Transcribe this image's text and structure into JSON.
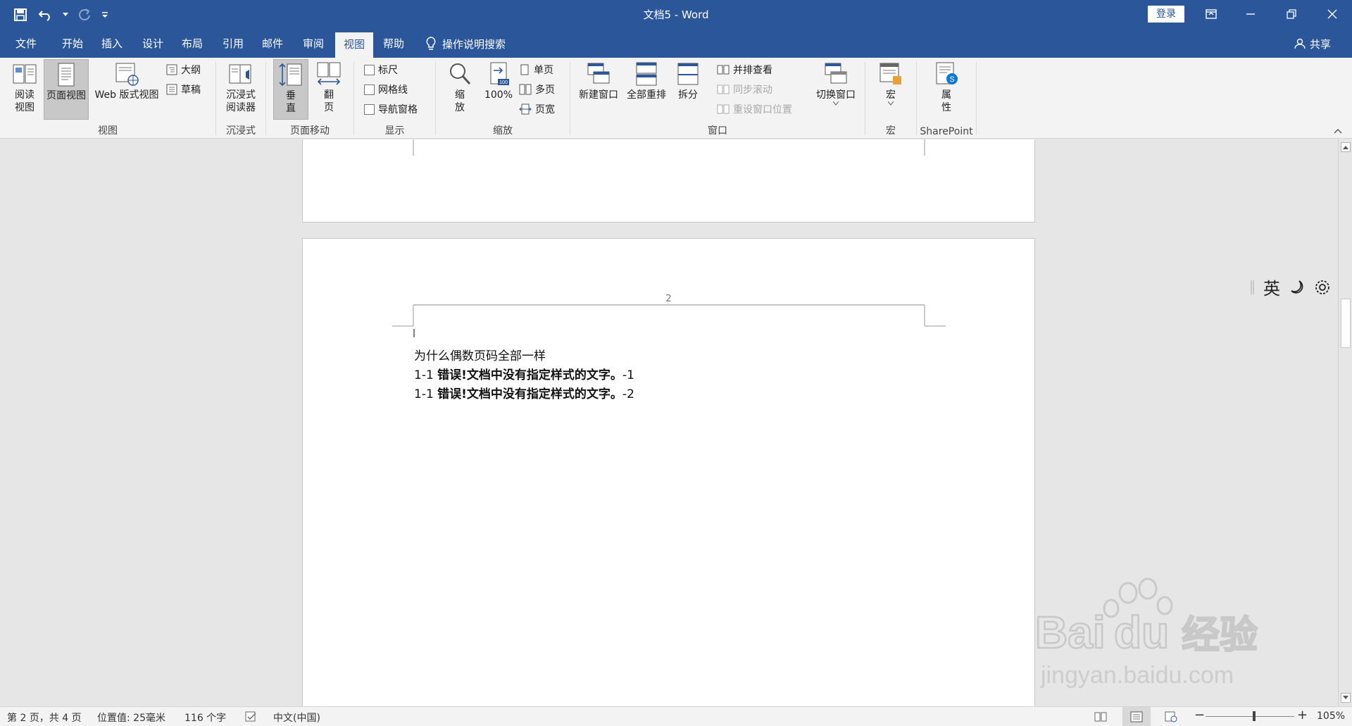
{
  "window": {
    "title": "文档5 - Word",
    "login_label": "登录",
    "controls": [
      "ribbon-display-options",
      "minimize",
      "restore",
      "close"
    ]
  },
  "qat": {
    "icons": [
      "save-icon",
      "undo-icon",
      "redo-icon",
      "customize-icon"
    ]
  },
  "tabs": [
    {
      "label": "文件"
    },
    {
      "label": "开始"
    },
    {
      "label": "插入"
    },
    {
      "label": "设计"
    },
    {
      "label": "布局"
    },
    {
      "label": "引用"
    },
    {
      "label": "邮件"
    },
    {
      "label": "审阅"
    },
    {
      "label": "视图",
      "active": true
    },
    {
      "label": "帮助"
    }
  ],
  "tell_me": "操作说明搜索",
  "share": "共享",
  "ribbon": {
    "views": {
      "group_label": "视图",
      "read_mode": "阅读\n视图",
      "print_layout": "页面视图",
      "web_layout": "Web 版式视图",
      "outline": "大纲",
      "draft": "草稿"
    },
    "immersive": {
      "group_label": "沉浸式",
      "reader": "沉浸式\n阅读器"
    },
    "page_movement": {
      "group_label": "页面移动",
      "vertical": "垂\n直",
      "side_to_side": "翻\n页"
    },
    "show": {
      "group_label": "显示",
      "ruler": "标尺",
      "gridlines": "网格线",
      "nav_pane": "导航窗格"
    },
    "zoom": {
      "group_label": "缩放",
      "zoom": "缩\n放",
      "zoom_100": "100%",
      "one_page": "单页",
      "multiple_pages": "多页",
      "page_width": "页宽"
    },
    "window": {
      "group_label": "窗口",
      "new_window": "新建窗口",
      "arrange_all": "全部重排",
      "split": "拆分",
      "side_by_side": "并排查看",
      "sync_scroll": "同步滚动",
      "reset_position": "重设窗口位置",
      "switch_windows": "切换窗口"
    },
    "macros": {
      "group_label": "宏",
      "macros": "宏"
    },
    "sharepoint": {
      "group_label": "SharePoint",
      "properties": "属\n性"
    }
  },
  "document": {
    "page_number": "2",
    "lines": [
      {
        "text": "为什么偶数页码全部一样"
      },
      {
        "prefix": "1-1 ",
        "bold": "错误!文档中没有指定样式的文字。",
        "suffix": "-1"
      },
      {
        "prefix": "1-1 ",
        "bold": "错误!文档中没有指定样式的文字。",
        "suffix": "-2"
      }
    ]
  },
  "ime": {
    "lang": "英"
  },
  "status": {
    "page": "第 2 页，共 4 页",
    "position": "位置值: 25毫米",
    "words": "116 个字",
    "language": "中文(中国)",
    "zoom": "105%",
    "zoom_fraction": 0.55
  },
  "watermark": {
    "brand": "Bai",
    "brand2": "du",
    "cn": "经验",
    "url": "jingyan.baidu.com"
  }
}
